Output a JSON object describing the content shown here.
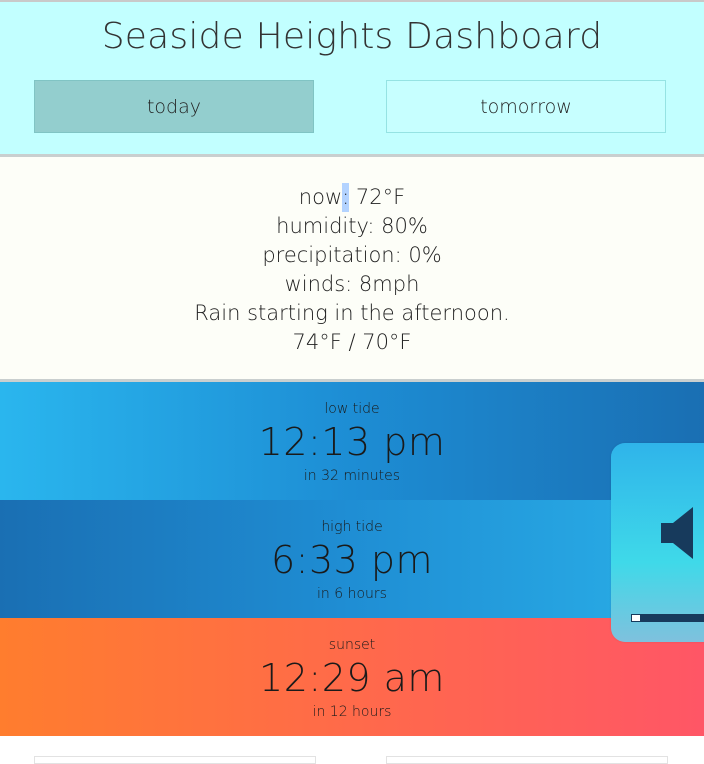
{
  "header": {
    "title": "Seaside Heights Dashboard",
    "tabs": [
      {
        "label": "today",
        "active": true
      },
      {
        "label": "tomorrow",
        "active": false
      }
    ]
  },
  "weather": {
    "now_prefix": "now",
    "now_colon": ":",
    "now_value": " 72°F",
    "humidity": "humidity: 80%",
    "precipitation": "precipitation: 0%",
    "winds": "winds: 8mph",
    "summary": "Rain starting in the afternoon.",
    "high_low": "74°F / 70°F"
  },
  "events": [
    {
      "label": "low tide",
      "time": "12:13 pm",
      "relative": "in 32 minutes"
    },
    {
      "label": "high tide",
      "time": "6:33 pm",
      "relative": "in 6 hours"
    },
    {
      "label": "sunset",
      "time": "12:29 am",
      "relative": "in 12 hours"
    }
  ],
  "volume_overlay": {
    "icon": "speaker-icon",
    "level": 0.12
  },
  "colors": {
    "header_bg": "#c2ffff",
    "active_tab": "#93cece",
    "weather_bg": "#fdfef8",
    "tide_blue": "#1d8dd4",
    "sunset_orange": "#ff6a4a"
  }
}
